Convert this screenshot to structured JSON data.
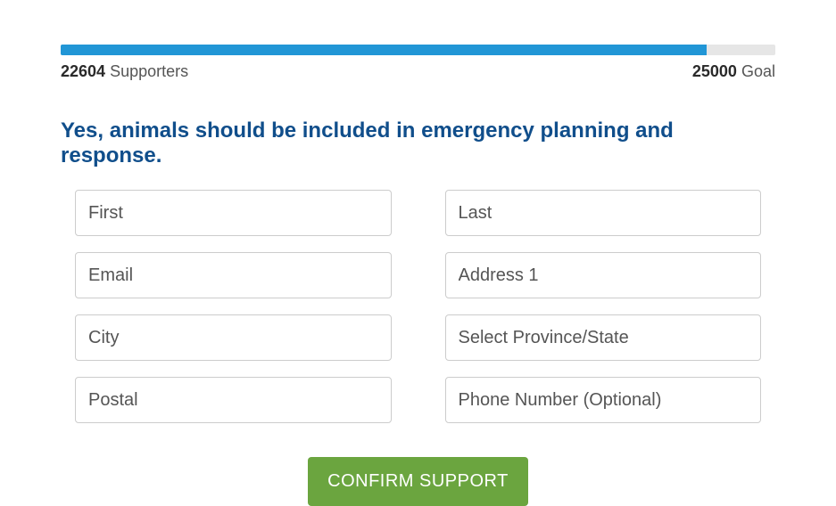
{
  "progress": {
    "current_count": "22604",
    "current_label": "Supporters",
    "goal_count": "25000",
    "goal_label": "Goal",
    "percent_width": "90.4%"
  },
  "heading": "Yes, animals should be included in emergency planning and response.",
  "fields": {
    "first_placeholder": "First",
    "last_placeholder": "Last",
    "email_placeholder": "Email",
    "address_placeholder": "Address 1",
    "city_placeholder": "City",
    "province_placeholder": "Select Province/State",
    "postal_placeholder": "Postal",
    "phone_placeholder": "Phone Number (Optional)"
  },
  "submit_label": "CONFIRM SUPPORT"
}
